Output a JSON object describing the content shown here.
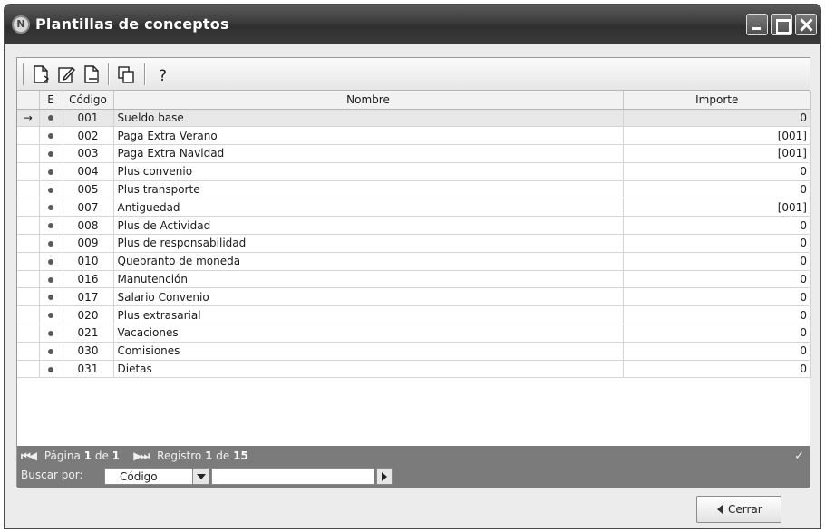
{
  "window": {
    "title": "Plantillas de conceptos",
    "app_icon_glyph": "N"
  },
  "toolbar": {
    "icons": [
      "new-document-icon",
      "edit-document-icon",
      "copy-document-icon",
      "duplicate-icon",
      "help-icon"
    ]
  },
  "grid": {
    "columns": {
      "e": "E",
      "codigo": "Código",
      "nombre": "Nombre",
      "importe": "Importe"
    },
    "current_row_marker": "→",
    "rows": [
      {
        "codigo": "001",
        "nombre": "Sueldo base",
        "importe": "0"
      },
      {
        "codigo": "002",
        "nombre": "Paga Extra Verano",
        "importe": "[001]"
      },
      {
        "codigo": "003",
        "nombre": "Paga Extra Navidad",
        "importe": "[001]"
      },
      {
        "codigo": "004",
        "nombre": "Plus convenio",
        "importe": "0"
      },
      {
        "codigo": "005",
        "nombre": "Plus transporte",
        "importe": "0"
      },
      {
        "codigo": "007",
        "nombre": "Antiguedad",
        "importe": "[001]"
      },
      {
        "codigo": "008",
        "nombre": "Plus de Actividad",
        "importe": "0"
      },
      {
        "codigo": "009",
        "nombre": "Plus de responsabilidad",
        "importe": "0"
      },
      {
        "codigo": "010",
        "nombre": "Quebranto de moneda",
        "importe": "0"
      },
      {
        "codigo": "016",
        "nombre": "Manutención",
        "importe": "0"
      },
      {
        "codigo": "017",
        "nombre": "Salario Convenio",
        "importe": "0"
      },
      {
        "codigo": "020",
        "nombre": "Plus extrasarial",
        "importe": "0"
      },
      {
        "codigo": "021",
        "nombre": "Vacaciones",
        "importe": "0"
      },
      {
        "codigo": "030",
        "nombre": "Comisiones",
        "importe": "0"
      },
      {
        "codigo": "031",
        "nombre": "Dietas",
        "importe": "0"
      }
    ]
  },
  "navigation": {
    "first_prev": "⏮◀",
    "page_label": "Página",
    "page_current": "1",
    "of": "de",
    "page_total": "1",
    "next_last": "▶⏭",
    "record_label": "Registro",
    "record_current": "1",
    "record_total": "15",
    "search_label": "Buscar por:",
    "search_field": "Código",
    "search_value": ""
  },
  "footer": {
    "close_label": "Cerrar"
  }
}
